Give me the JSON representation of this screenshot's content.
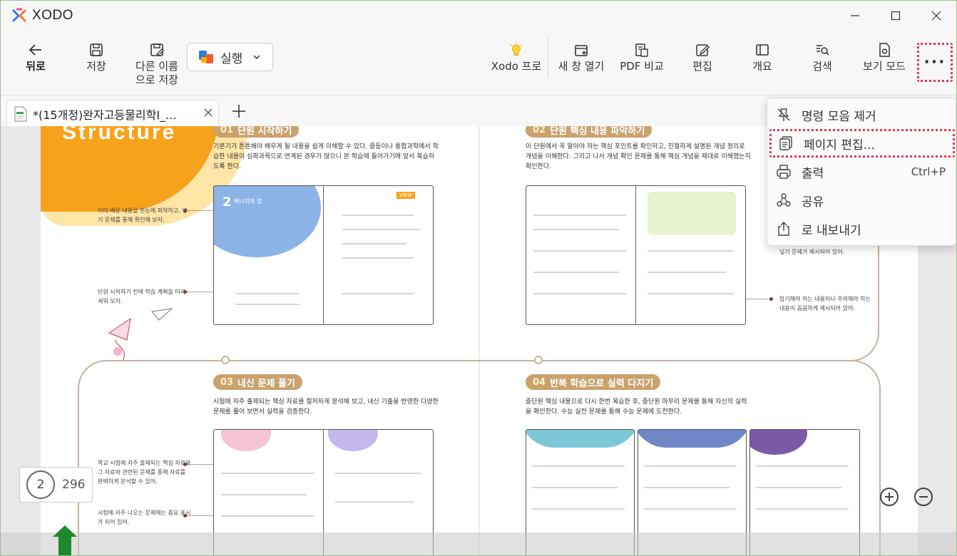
{
  "app": {
    "name": "XODO"
  },
  "window_controls": {
    "minimize": "minimize-icon",
    "maximize": "maximize-icon",
    "close": "close-icon"
  },
  "toolbar": {
    "back": "뒤로",
    "save": "저장",
    "save_as_line1": "다른 이름",
    "save_as_line2": "으로 저장",
    "run": "실행",
    "xodo_pro": "Xodo 프로",
    "new_window": "새 창 열기",
    "pdf_compare": "PDF 비교",
    "edit": "편집",
    "overview": "개요",
    "search": "검색",
    "view_mode": "보기 모드",
    "more": "···"
  },
  "tabs": [
    {
      "title": "*(15개정)완자고등물리학Ⅰ_...",
      "close": "×"
    }
  ],
  "tab_add": "+",
  "menu": {
    "items": [
      {
        "label": "명령 모음 제거",
        "icon": "unpin-icon",
        "shortcut": ""
      },
      {
        "label": "페이지 편집...",
        "icon": "pages-icon",
        "shortcut": ""
      },
      {
        "label": "출력",
        "icon": "printer-icon",
        "shortcut": "Ctrl+P"
      },
      {
        "label": "공유",
        "icon": "share-icon",
        "shortcut": ""
      },
      {
        "label": "로 내보내기",
        "icon": "export-icon",
        "shortcut": ""
      }
    ]
  },
  "document": {
    "header_word": "Structure",
    "sections": [
      {
        "num": "01",
        "title": "단원 시작하기",
        "desc": "기본기가 튼튼해야 배우게 될 내용을 쉽게 이해할 수 있다. 중등이나 통합과학에서 학습한 내용이 심화과목으로 연계된 경우가 많으니 본 학습에 들어가기에 앞서 복습하도록 한다."
      },
      {
        "num": "02",
        "title": "단원 핵심 내용 파악하기",
        "desc": "이 단원에서 꼭 알아야 하는 핵심 포인트를 확인하고, 친절하게 설명된 개념 정리로 개념을 이해한다. 그리고 나서 개념 확인 문제를 통해 핵심 개념을 제대로 이해했는지 확인한다."
      },
      {
        "num": "03",
        "title": "내신 문제 풀기",
        "desc": "시험에 자주 출제되는 핵심 자료를 철저하게 분석해 보고, 내신 기출을 반영한 다양한 문제를 풀어 보면서 실력을 검증한다."
      },
      {
        "num": "04",
        "title": "반복 학습으로 실력 다지기",
        "desc": "중단원 핵심 내용으로 다시 한번 복습한 후, 중단원 마무리 문제를 통해 자신의 실력을 확인한다. 수능 실전 문제를 통해 수능 문제에 도전한다."
      }
    ],
    "side_notes": [
      "이미 배운 내용을 한눈에 파악하고, 넣기 문제를 통해 확인해 보자.",
      "단원 시작하기 전에 학습 계획을 미리 세워 보자.",
      "넣기 문제가 제시되어 있어.",
      "암기해야 하는 내용이나 주의해야 하는 내용이 꼼꼼하게 제시되어 있어.",
      "학교 시험에 자주 출제되는 핵심 자료와 그 자료와 관련된 문제를 통해 자료를 완벽하게 분석할 수 있어.",
      "시험에 자주 나오는 문제에는 중요 표시가 되어 있어."
    ],
    "thumb_labels": {
      "t1_title": "에너지와 열",
      "t1_badge": "VIEW"
    }
  },
  "page_counter": {
    "current": "2",
    "total": "296"
  },
  "colors": {
    "accent_red": "#e0384c",
    "pill": "#c9a26e",
    "orange": "#f7a21b"
  }
}
